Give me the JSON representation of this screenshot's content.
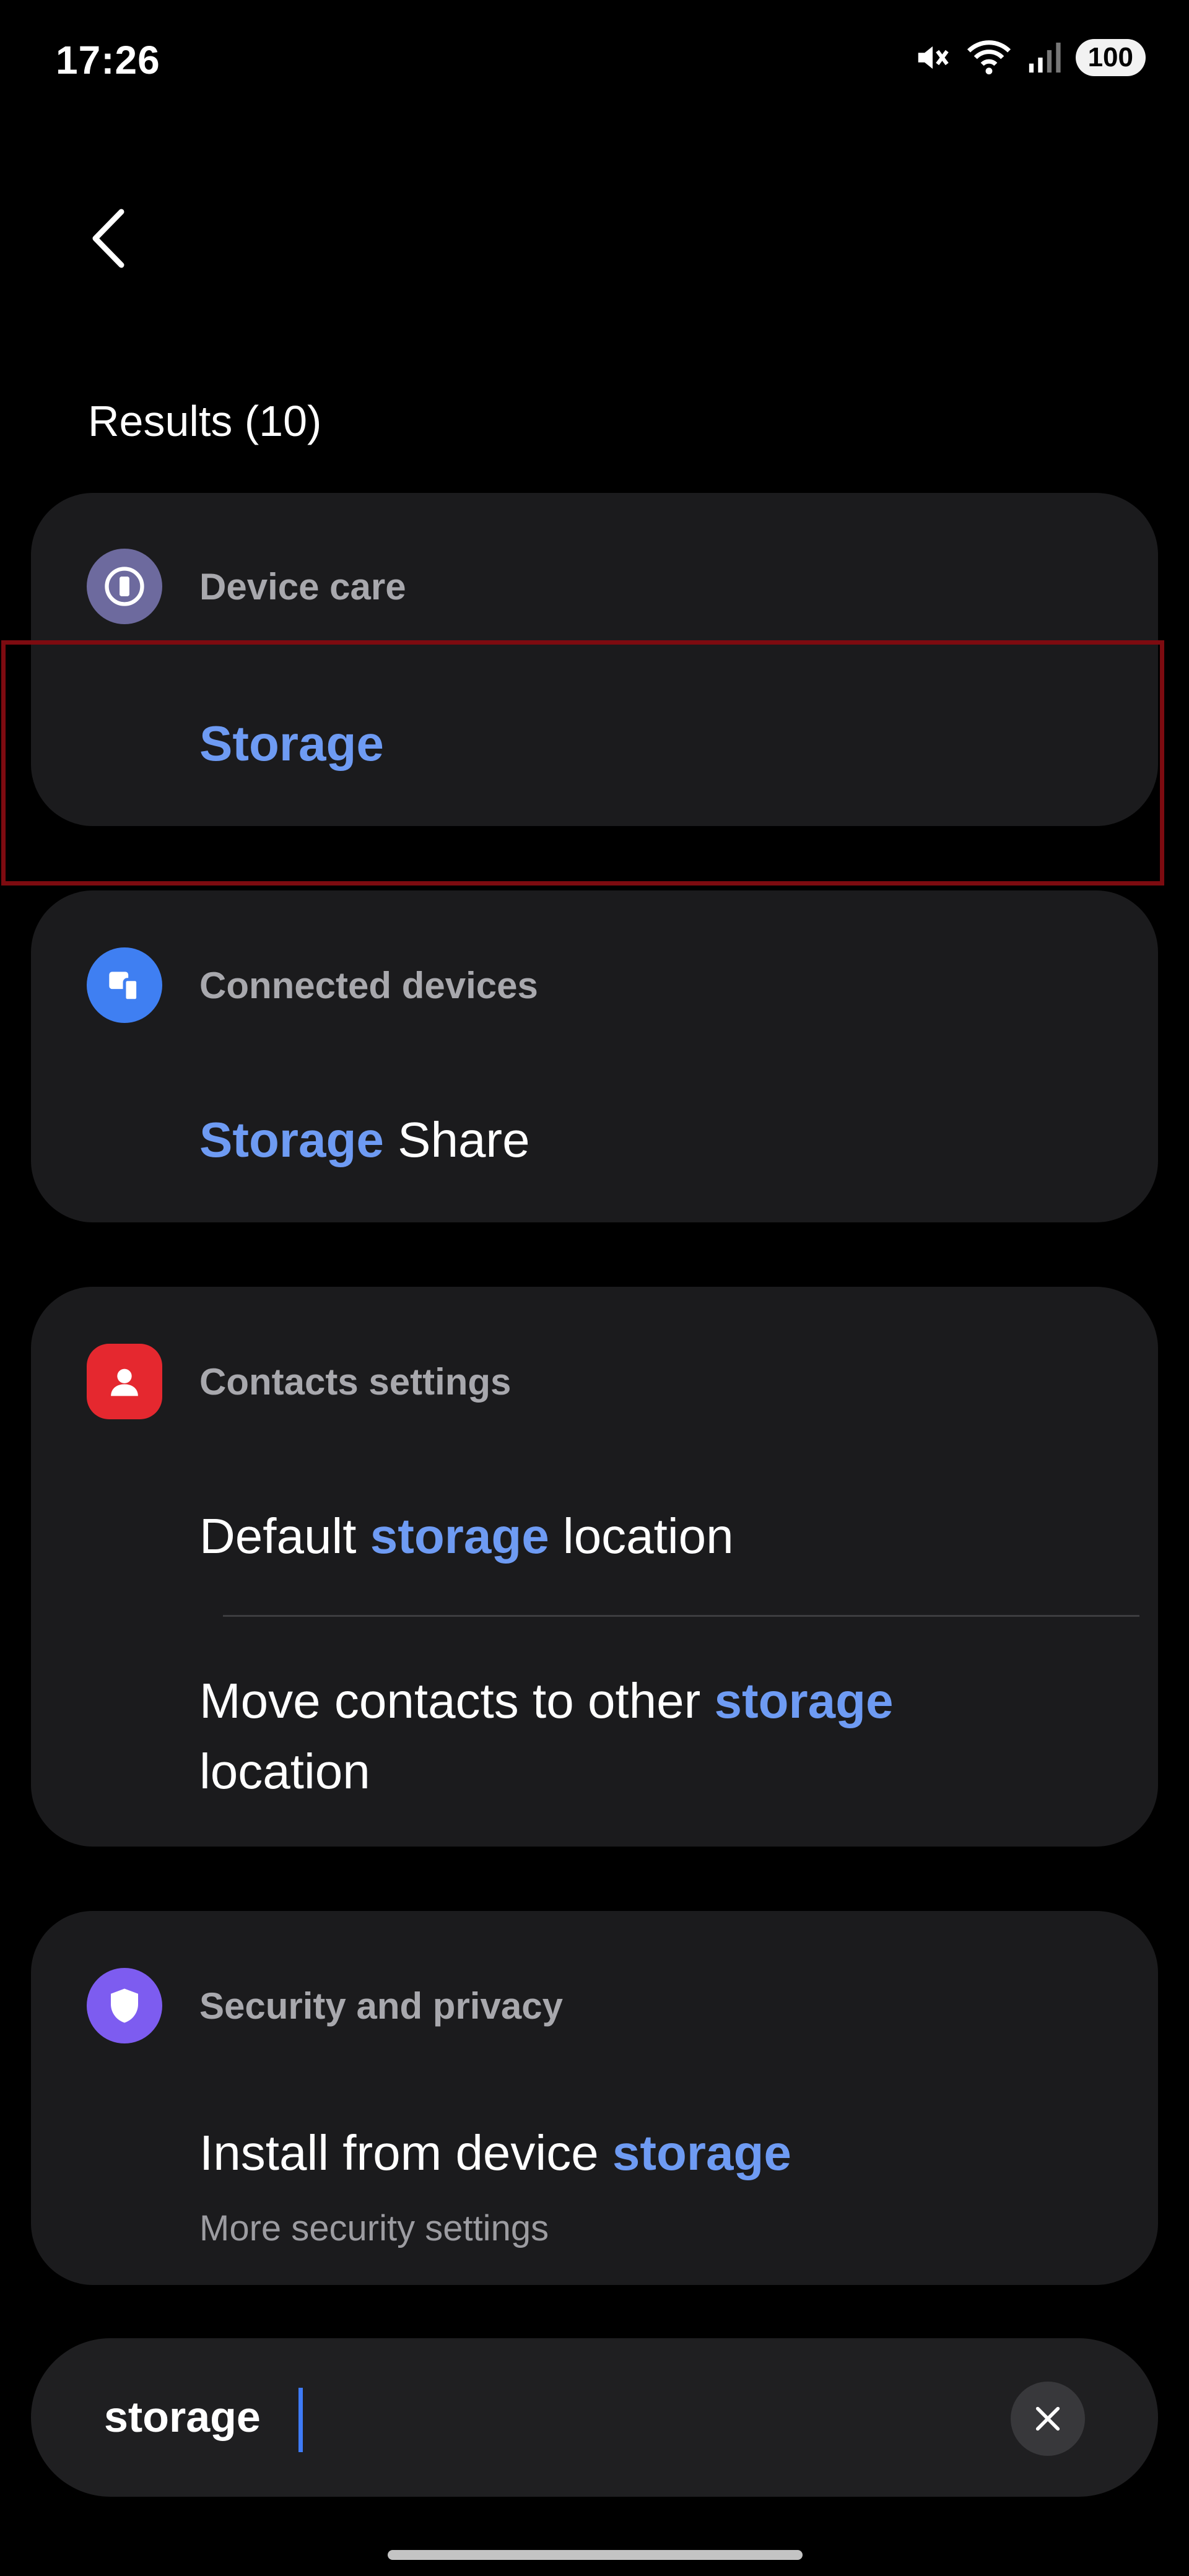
{
  "status_bar": {
    "time": "17:26",
    "battery": "100"
  },
  "header": {
    "results_label": "Results (10)"
  },
  "groups": [
    {
      "category": "Device care",
      "icon": "device-care-icon",
      "icon_color": "#6d6a9e",
      "items": [
        {
          "highlight": "Storage",
          "rest": ""
        }
      ]
    },
    {
      "category": "Connected devices",
      "icon": "connected-devices-icon",
      "icon_color": "#3f7ff2",
      "items": [
        {
          "highlight": "Storage",
          "rest": " Share"
        }
      ]
    },
    {
      "category": "Contacts settings",
      "icon": "contacts-icon",
      "icon_color": "#e5282f",
      "items": [
        {
          "before": "Default ",
          "highlight": "storage",
          "after": " location"
        },
        {
          "before": "Move contacts to other ",
          "highlight": "storage",
          "line2": "location"
        }
      ]
    },
    {
      "category": "Security and privacy",
      "icon": "shield-icon",
      "icon_color": "#7d5cf0",
      "items": [
        {
          "before": "Install from device ",
          "highlight": "storage",
          "subtitle": "More security settings"
        }
      ]
    }
  ],
  "search": {
    "value": "storage",
    "placeholder": ""
  },
  "colors": {
    "highlight": "#6e9bf3",
    "card": "#1b1b1d",
    "selection_frame": "#7d0b10",
    "caret": "#3e7bf7"
  }
}
